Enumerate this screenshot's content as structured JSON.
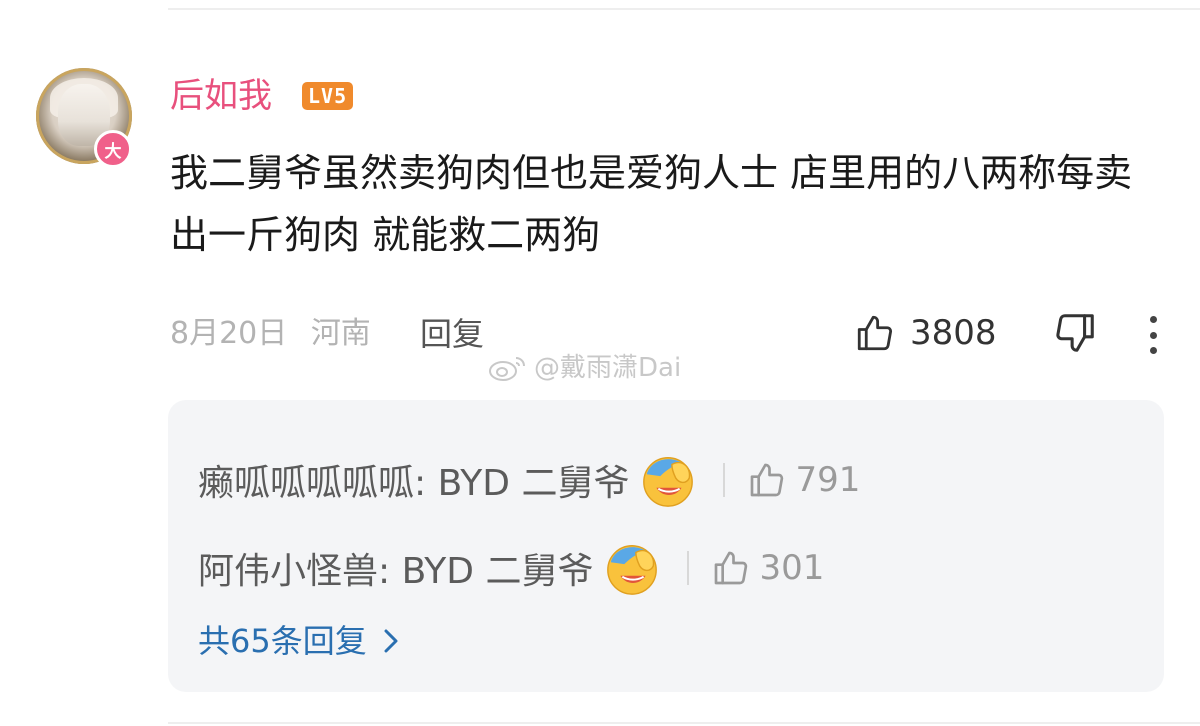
{
  "comment": {
    "username": "后如我",
    "level_badge": "LV5",
    "avatar_badge": "大",
    "text": "我二舅爷虽然卖狗肉但也是爱狗人士 店里用的八两称每卖出一斤狗肉 就能救二两狗",
    "date": "8月20日",
    "location": "河南",
    "reply_label": "回复",
    "like_count": "3808",
    "username_color": "#e8507d",
    "level_color": "#f08a2c"
  },
  "watermark": {
    "text": "@戴雨潇Dai",
    "icon": "weibo-logo-icon"
  },
  "replies": [
    {
      "author_and_text": "癞呱呱呱呱呱: BYD 二舅爷",
      "emoji": "facepalm-laugh-emoji",
      "like_count": "791"
    },
    {
      "author_and_text": "阿伟小怪兽: BYD 二舅爷",
      "emoji": "facepalm-laugh-emoji",
      "like_count": "301"
    }
  ],
  "more_replies_label": "共65条回复",
  "link_color": "#2a6fb0"
}
